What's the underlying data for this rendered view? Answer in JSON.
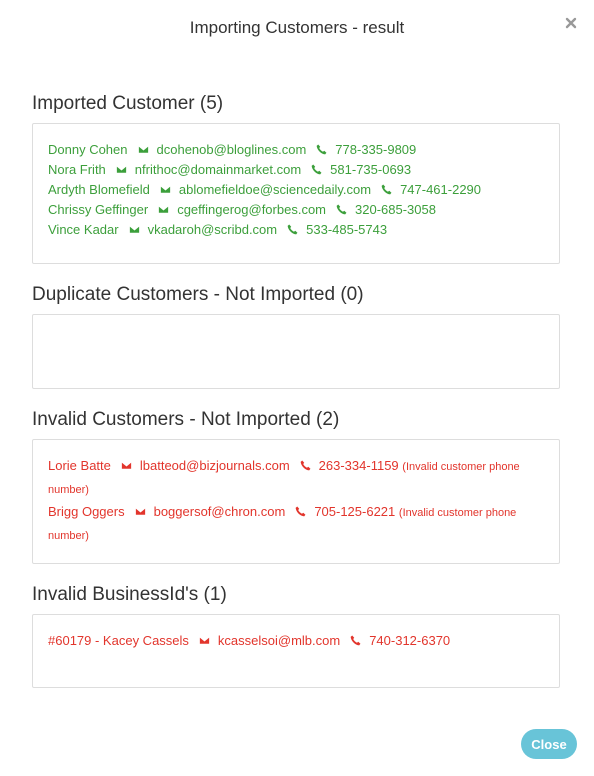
{
  "modal": {
    "title": "Importing Customers - result",
    "close_label": "Close"
  },
  "colors": {
    "success": "#3c9f3b",
    "error": "#e2352c",
    "button": "#68c4d8"
  },
  "imported": {
    "title": "Imported Customer (5)",
    "rows": [
      {
        "name": "Donny Cohen",
        "email": "dcohenob@bloglines.com",
        "phone": "778-335-9809"
      },
      {
        "name": "Nora Frith",
        "email": "nfrithoc@domainmarket.com",
        "phone": "581-735-0693"
      },
      {
        "name": "Ardyth Blomefield",
        "email": "ablomefieldoe@sciencedaily.com",
        "phone": "747-461-2290"
      },
      {
        "name": "Chrissy Geffinger",
        "email": "cgeffingerog@forbes.com",
        "phone": "320-685-3058"
      },
      {
        "name": "Vince Kadar",
        "email": "vkadaroh@scribd.com",
        "phone": "533-485-5743"
      }
    ]
  },
  "duplicates": {
    "title": "Duplicate Customers - Not Imported (0)",
    "rows": []
  },
  "invalid": {
    "title": "Invalid Customers - Not Imported (2)",
    "rows": [
      {
        "name": "Lorie Batte",
        "email": "lbatteod@bizjournals.com",
        "phone": "263-334-1159",
        "note": "(Invalid customer phone number)"
      },
      {
        "name": "Brigg Oggers",
        "email": "boggersof@chron.com",
        "phone": "705-125-6221",
        "note": "(Invalid customer phone number)"
      }
    ]
  },
  "invalid_business": {
    "title": "Invalid BusinessId's (1)",
    "rows": [
      {
        "name": "#60179 - Kacey Cassels",
        "email": "kcasselsoi@mlb.com",
        "phone": "740-312-6370"
      }
    ]
  },
  "icons": {
    "close": "close-icon",
    "email": "envelope-icon",
    "phone": "phone-icon"
  }
}
